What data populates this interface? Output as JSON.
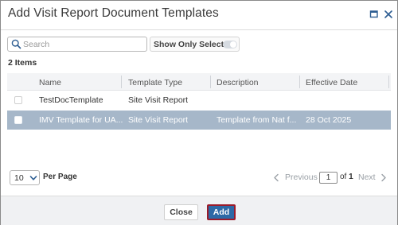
{
  "dialog": {
    "title": "Add Visit Report Document Templates",
    "icons": {
      "maximize": "maximize-icon",
      "close": "close-icon"
    }
  },
  "search": {
    "placeholder": "Search",
    "value": "",
    "icon": "search-icon"
  },
  "filter": {
    "show_only_selected_label": "Show Only Selected",
    "show_only_selected": false
  },
  "items_count": "2 Items",
  "table": {
    "columns": [
      "Name",
      "Template Type",
      "Description",
      "Effective Date"
    ],
    "rows": [
      {
        "selected": false,
        "name": "TestDocTemplate",
        "template_type": "Site Visit Report",
        "description": "",
        "effective_date": ""
      },
      {
        "selected": true,
        "name": "IMV Template for UA...",
        "template_type": "Site Visit Report",
        "description": "Template from Nat f...",
        "effective_date": "28 Oct 2025"
      }
    ]
  },
  "pagination": {
    "page_size": "10",
    "per_page_label": "Per Page",
    "previous_label": "Previous",
    "current_page": "1",
    "of_label": "of",
    "total_pages": "1",
    "next_label": "Next"
  },
  "footer": {
    "close_label": "Close",
    "add_label": "Add"
  },
  "colors": {
    "accent": "#2d69a6",
    "selected_row": "#a6b7c9",
    "add_border": "#9b1b2a"
  }
}
